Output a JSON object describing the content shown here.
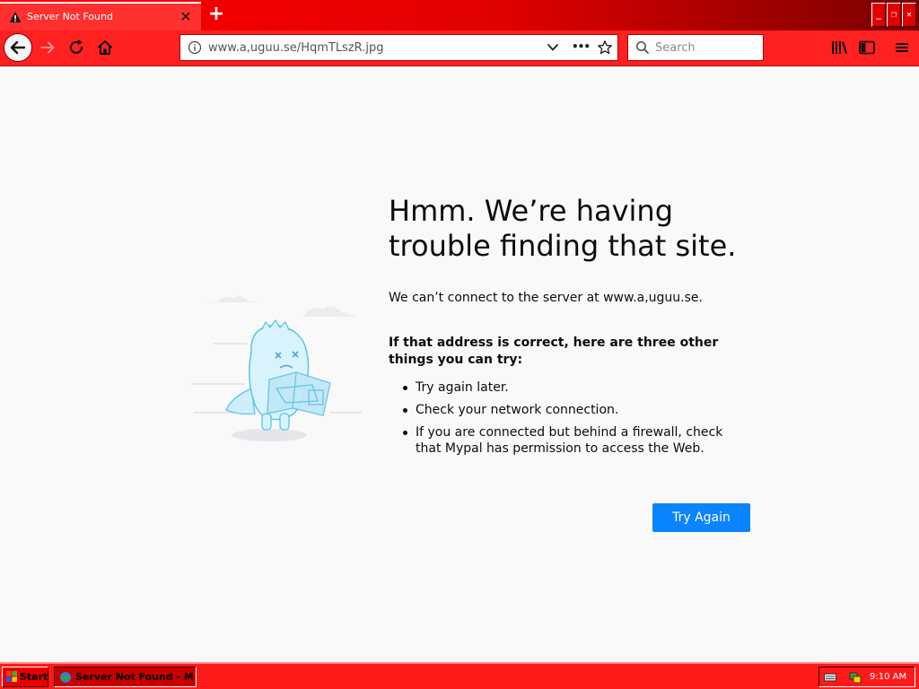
{
  "tab": {
    "title": "Server Not Found",
    "close_glyph": "✕",
    "new_tab_glyph": "+"
  },
  "window_controls": {
    "minimize": "_",
    "restore": "❐",
    "close": "✕"
  },
  "navbar": {
    "url": "www.a,uguu.se/HqmTLszR.jpg",
    "more_glyph": "•••",
    "search_placeholder": "Search"
  },
  "error": {
    "title": "Hmm. We’re having trouble finding that site.",
    "description": "We can’t connect to the server at www.a,uguu.se.",
    "suggestions_heading": "If that address is correct, here are three other things you can try:",
    "suggestions": [
      "Try again later.",
      "Check your network connection.",
      "If you are connected but behind a firewall, check that Mypal has permission to access the Web."
    ],
    "try_again_label": "Try Again"
  },
  "taskbar": {
    "start_label": "Start",
    "task_label": "Server Not Found - M...",
    "clock": "9:10 AM"
  },
  "colors": {
    "accent_red": "#ff0000",
    "button_blue": "#0a84ff",
    "page_bg": "#f9f9fa"
  },
  "icons": {
    "warning": "warning-icon",
    "back": "back-arrow-icon",
    "forward": "forward-arrow-icon",
    "reload": "reload-icon",
    "home": "home-icon",
    "info": "info-icon",
    "dropdown": "chevron-down-icon",
    "bookmark": "star-icon",
    "search": "search-icon",
    "library": "library-icon",
    "sidebar": "sidebar-icon",
    "menu": "hamburger-menu-icon"
  }
}
